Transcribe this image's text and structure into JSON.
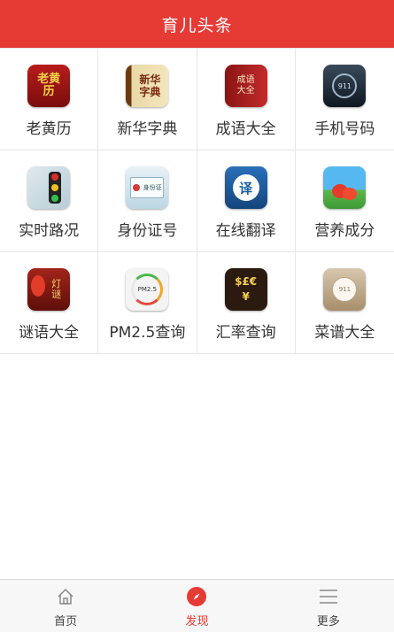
{
  "header": {
    "title": "育儿头条"
  },
  "apps": [
    {
      "label": "老黄历",
      "icon": "almanac-icon",
      "icon_text": "老黄历"
    },
    {
      "label": "新华字典",
      "icon": "dictionary-icon",
      "icon_text": "新华字典"
    },
    {
      "label": "成语大全",
      "icon": "idiom-book-icon",
      "icon_text": "成语大全"
    },
    {
      "label": "手机号码",
      "icon": "phone-number-icon",
      "icon_text": "911"
    },
    {
      "label": "实时路况",
      "icon": "traffic-light-icon",
      "icon_text": ""
    },
    {
      "label": "身份证号",
      "icon": "id-card-icon",
      "icon_text": "身份证"
    },
    {
      "label": "在线翻译",
      "icon": "translate-icon",
      "icon_text": "译"
    },
    {
      "label": "营养成分",
      "icon": "nutrition-icon",
      "icon_text": ""
    },
    {
      "label": "谜语大全",
      "icon": "lantern-riddle-icon",
      "icon_text": "灯谜"
    },
    {
      "label": "PM2.5查询",
      "icon": "pm25-gauge-icon",
      "icon_text": "PM2.5"
    },
    {
      "label": "汇率查询",
      "icon": "currency-icon",
      "icon_text": "$£€¥"
    },
    {
      "label": "菜谱大全",
      "icon": "recipe-plate-icon",
      "icon_text": "911"
    }
  ],
  "tabs": [
    {
      "label": "首页",
      "icon": "home-icon"
    },
    {
      "label": "发现",
      "icon": "compass-icon"
    },
    {
      "label": "更多",
      "icon": "menu-icon"
    }
  ],
  "colors": {
    "accent": "#e63a35",
    "text": "#333333",
    "divider": "#e6e6e6"
  }
}
